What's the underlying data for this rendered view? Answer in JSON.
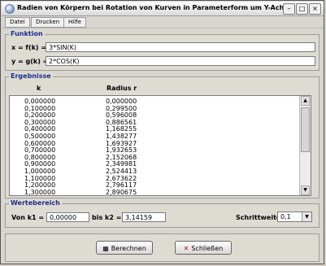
{
  "window": {
    "title": "Radien von Körpern bei Rotation von Kurven in Parameterform um Y-Achse"
  },
  "menu": [
    "Datei",
    "Drucken",
    "Hilfe"
  ],
  "function_group": {
    "label": "Funktion",
    "x_label": "x = f(k) =",
    "x_value": "3*SIN(K)",
    "y_label": "y = g(k) =",
    "y_value": "2*COS(K)"
  },
  "results": {
    "label": "Ergebnisse",
    "col_k": "k",
    "col_r": "Radius r",
    "rows": [
      [
        "0,000000",
        "0,000000"
      ],
      [
        "0,100000",
        "0,299500"
      ],
      [
        "0,200000",
        "0,596008"
      ],
      [
        "0,300000",
        "0,886561"
      ],
      [
        "0,400000",
        "1,168255"
      ],
      [
        "0,500000",
        "1,438277"
      ],
      [
        "0,600000",
        "1,693927"
      ],
      [
        "0,700000",
        "1,932653"
      ],
      [
        "0,800000",
        "2,152068"
      ],
      [
        "0,900000",
        "2,349981"
      ],
      [
        "1,000000",
        "2,524413"
      ],
      [
        "1,100000",
        "2,673622"
      ],
      [
        "1,200000",
        "2,796117"
      ],
      [
        "1,300000",
        "2,890675"
      ]
    ]
  },
  "range": {
    "label": "Wertebereich",
    "from_label": "Von k1 =",
    "from_value": "0,00000",
    "to_label": "bis k2 =",
    "to_value": "3,14159",
    "step_label": "Schrittweite:",
    "step_value": "0,1"
  },
  "buttons": {
    "calc": "Berechnen",
    "close": "Schließen"
  },
  "colors": {
    "group_label": "#1c2c8c",
    "close_icon": "#cc0000"
  }
}
